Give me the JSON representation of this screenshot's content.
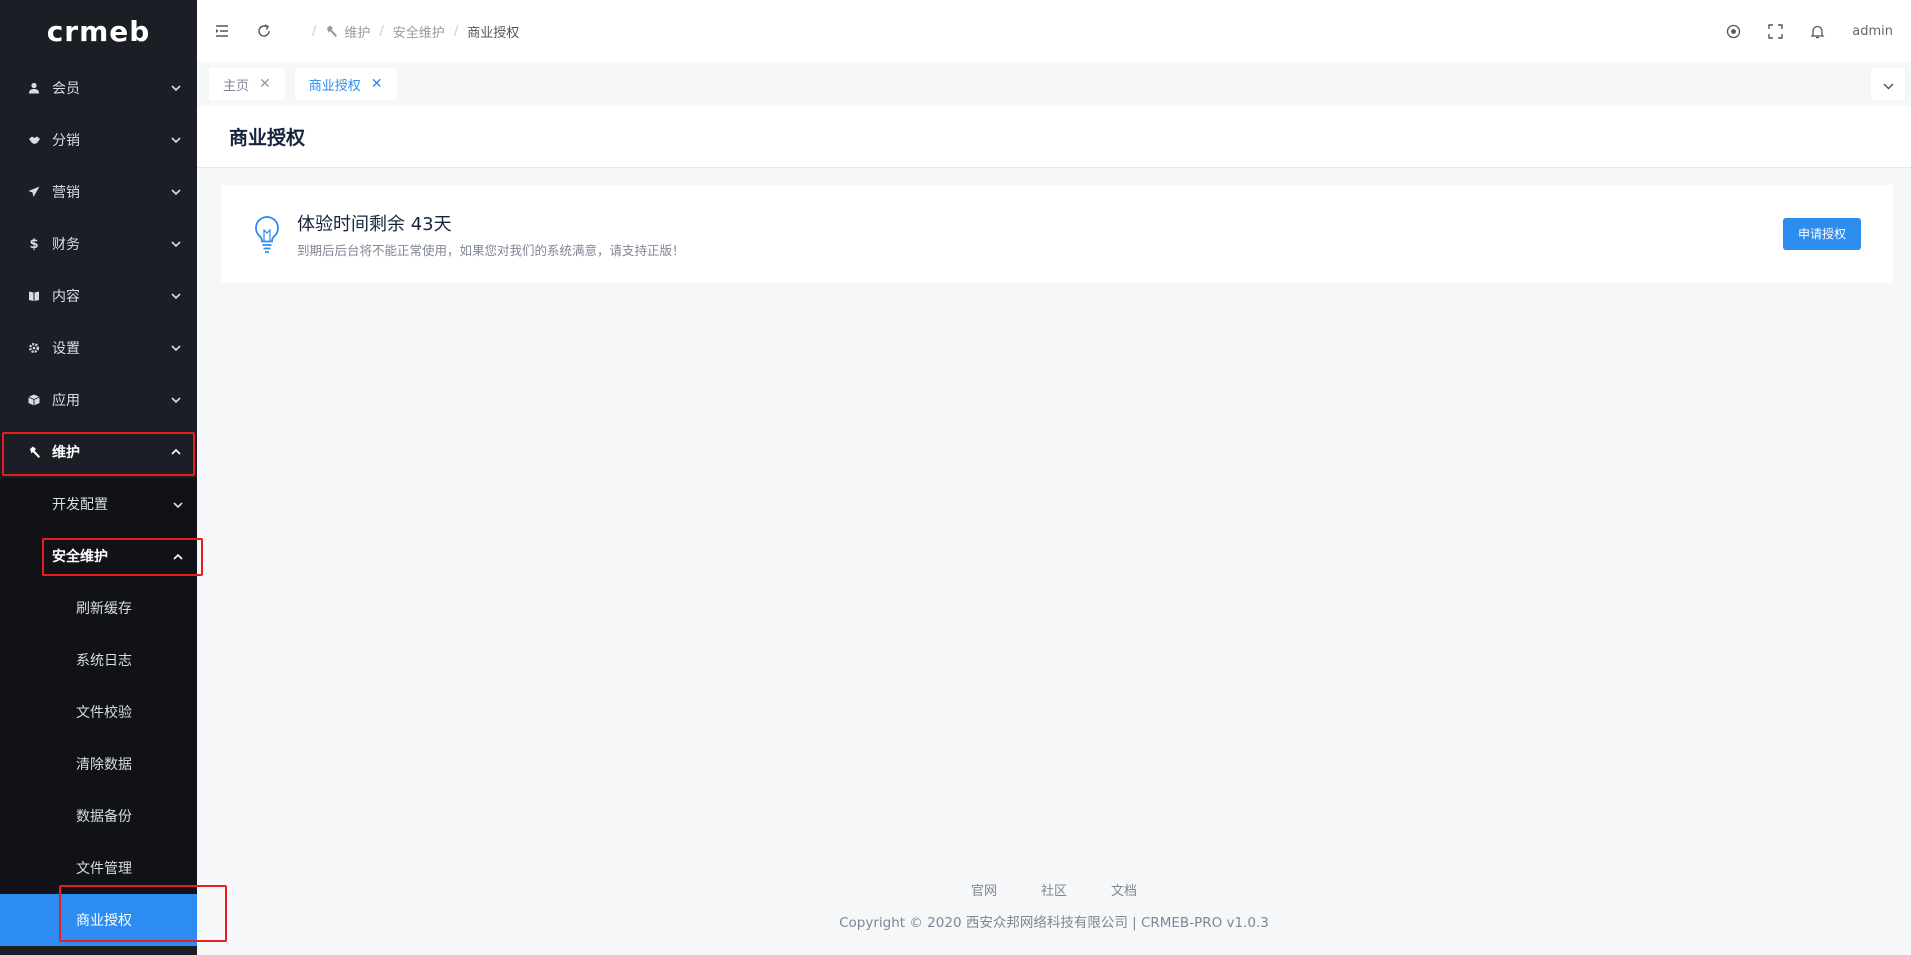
{
  "logo": "crmeb",
  "sidebar": {
    "items": [
      {
        "label": "会员",
        "icon": "user-icon"
      },
      {
        "label": "分销",
        "icon": "handshake-icon"
      },
      {
        "label": "营销",
        "icon": "paper-plane-icon"
      },
      {
        "label": "财务",
        "icon": "dollar-icon"
      },
      {
        "label": "内容",
        "icon": "book-icon"
      },
      {
        "label": "设置",
        "icon": "gear-icon"
      },
      {
        "label": "应用",
        "icon": "cube-icon"
      },
      {
        "label": "维护",
        "icon": "hammer-icon"
      }
    ],
    "sub": {
      "dev_config": "开发配置",
      "security": "安全维护"
    },
    "leaves": [
      "刷新缓存",
      "系统日志",
      "文件校验",
      "清除数据",
      "数据备份",
      "文件管理",
      "商业授权"
    ]
  },
  "header": {
    "breadcrumb": [
      "维护",
      "安全维护",
      "商业授权"
    ],
    "user": "admin"
  },
  "tabs": [
    {
      "label": "主页"
    },
    {
      "label": "商业授权"
    }
  ],
  "page": {
    "title": "商业授权"
  },
  "notice": {
    "title": "体验时间剩余 43天",
    "desc": "到期后后台将不能正常使用，如果您对我们的系统满意，请支持正版！",
    "button": "申请授权"
  },
  "footer": {
    "links": [
      "官网",
      "社区",
      "文档"
    ],
    "copyright": "Copyright © 2020 西安众邦网络科技有限公司 | CRMEB-PRO v1.0.3"
  },
  "colors": {
    "accent": "#2d8cf0",
    "sidebar_bg": "#1b1e25",
    "highlight": "#e81e1e"
  }
}
